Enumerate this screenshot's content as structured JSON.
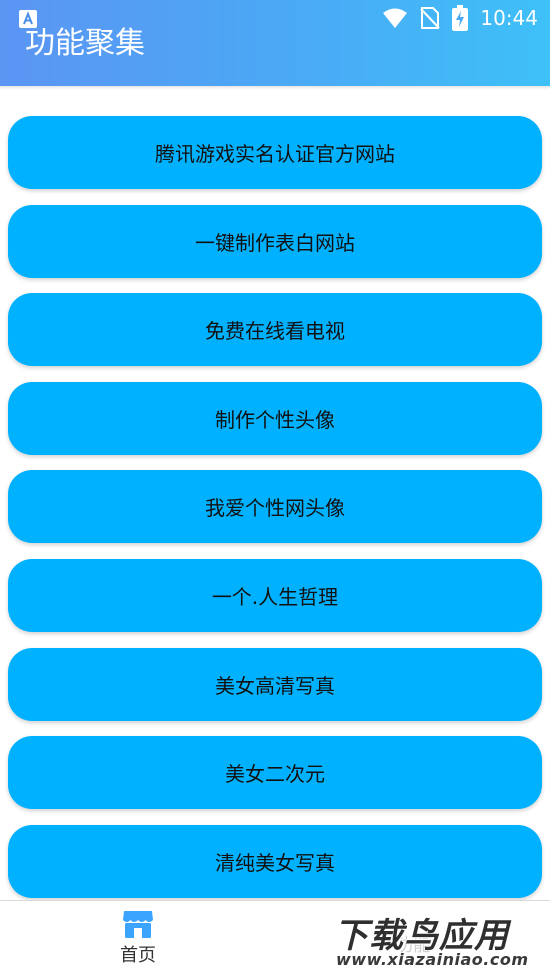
{
  "status_bar": {
    "time": "10:44",
    "icons": [
      "app-notification-icon",
      "wifi-icon",
      "no-sim-icon",
      "battery-charging-icon"
    ]
  },
  "header": {
    "title": "功能聚集"
  },
  "menu": {
    "items": [
      {
        "label": "腾讯游戏实名认证官方网站"
      },
      {
        "label": "一键制作表白网站"
      },
      {
        "label": "免费在线看电视"
      },
      {
        "label": "制作个性头像"
      },
      {
        "label": "我爱个性网头像"
      },
      {
        "label": "一个.人生哲理"
      },
      {
        "label": "美女高清写真"
      },
      {
        "label": "美女二次元"
      },
      {
        "label": "清纯美女写真"
      }
    ]
  },
  "bottom_nav": {
    "home_label": "首页",
    "features_label": "功能",
    "home_icon": "store-icon"
  },
  "watermark": {
    "title": "下载鸟应用",
    "url": "www.xiazainiao.com"
  },
  "colors": {
    "header_start": "#5b95f3",
    "header_end": "#3ec0f8",
    "button": "#00b1ff",
    "nav_icon": "#3aa4ff"
  }
}
